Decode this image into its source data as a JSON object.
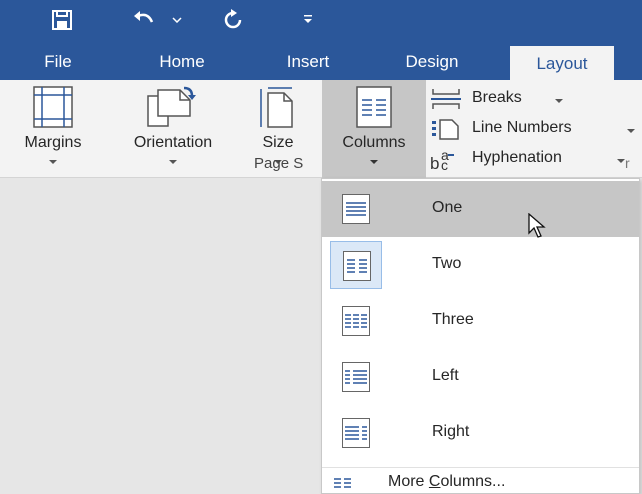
{
  "tabs": [
    {
      "label": "File"
    },
    {
      "label": "Home"
    },
    {
      "label": "Insert"
    },
    {
      "label": "Design"
    },
    {
      "label": "Layout"
    }
  ],
  "ribbon": {
    "margins": "Margins",
    "orientation": "Orientation",
    "size": "Size",
    "columns": "Columns",
    "breaks": "Breaks",
    "line_numbers": "Line Numbers",
    "hyphenation": "Hyphenation",
    "group_label": "Page S",
    "next_group_fragment": "r"
  },
  "menu": {
    "items": [
      {
        "label": "One"
      },
      {
        "label": "Two"
      },
      {
        "label": "Three"
      },
      {
        "label": "Left"
      },
      {
        "label": "Right"
      }
    ],
    "more_prefix": "More ",
    "more_underline": "C",
    "more_suffix": "olumns..."
  },
  "colors": {
    "title_bar": "#2b579a",
    "ribbon_bg": "#f3f3f3",
    "hover_bg": "#c6c6c6",
    "selected_border": "#98bde8",
    "icon_blue": "#2b579a"
  }
}
